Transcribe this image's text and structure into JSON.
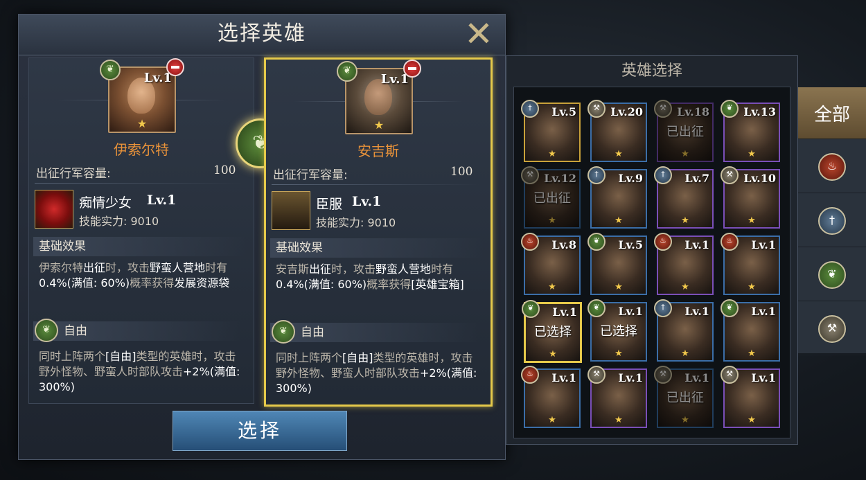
{
  "dialog": {
    "title": "选择英雄",
    "select_button": "选择"
  },
  "left_card": {
    "level": "Lv.1",
    "name": "伊索尔特",
    "capacity_label": "出征行军容量:",
    "capacity_value": "100",
    "skill_name": "痴情少女",
    "skill_level": "Lv.1",
    "skill_power": "技能实力: 9010",
    "section_title": "基础效果",
    "desc_parts": [
      "伊索尔特",
      "出征",
      "时，攻击",
      "野蛮人营地",
      "时有",
      "0.4%(满值: 60%)",
      "概率获得",
      "发展资源袋"
    ],
    "trait_name": "自由",
    "trait_parts": [
      "同时上阵两个",
      "[自由]",
      "类型的英雄时，攻击野外怪物、野蛮人时部队攻击",
      "+2%(满值: 300%)"
    ]
  },
  "right_card": {
    "level": "Lv.1",
    "name": "安吉斯",
    "capacity_label": "出征行军容量:",
    "capacity_value": "100",
    "skill_name": "臣服",
    "skill_level": "Lv.1",
    "skill_power": "技能实力: 9010",
    "section_title": "基础效果",
    "desc_parts": [
      "安吉斯",
      "出征",
      "时，攻击",
      "野蛮人营地",
      "时有",
      "0.4%(满值: 60%)",
      "概率获得",
      "[英雄宝箱]"
    ],
    "trait_name": "自由",
    "trait_parts": [
      "同时上阵两个",
      "[自由]",
      "类型的英雄时，攻击野外怪物、野蛮人时部队攻击",
      "+2%(满值: 300%)"
    ]
  },
  "picker": {
    "title": "英雄选择",
    "cells": [
      {
        "lv": "Lv.5",
        "badge": "sword",
        "state": ""
      },
      {
        "lv": "Lv.20",
        "badge": "hammer",
        "state": ""
      },
      {
        "lv": "Lv.18",
        "badge": "hammer",
        "state": "已出征"
      },
      {
        "lv": "Lv.13",
        "badge": "leaf",
        "state": ""
      },
      {
        "lv": "Lv.12",
        "badge": "hammer",
        "state": "已出征"
      },
      {
        "lv": "Lv.9",
        "badge": "sword",
        "state": ""
      },
      {
        "lv": "Lv.7",
        "badge": "sword",
        "state": ""
      },
      {
        "lv": "Lv.10",
        "badge": "hammer",
        "state": ""
      },
      {
        "lv": "Lv.8",
        "badge": "fire",
        "state": ""
      },
      {
        "lv": "Lv.5",
        "badge": "leaf",
        "state": ""
      },
      {
        "lv": "Lv.1",
        "badge": "fire",
        "state": ""
      },
      {
        "lv": "Lv.1",
        "badge": "fire",
        "state": ""
      },
      {
        "lv": "Lv.1",
        "badge": "leaf",
        "state": "已选择"
      },
      {
        "lv": "Lv.1",
        "badge": "leaf",
        "state": "已选择"
      },
      {
        "lv": "Lv.1",
        "badge": "sword",
        "state": ""
      },
      {
        "lv": "Lv.1",
        "badge": "leaf",
        "state": ""
      },
      {
        "lv": "Lv.1",
        "badge": "fire",
        "state": ""
      },
      {
        "lv": "Lv.1",
        "badge": "hammer",
        "state": ""
      },
      {
        "lv": "Lv.1",
        "badge": "hammer",
        "state": "已出征"
      },
      {
        "lv": "Lv.1",
        "badge": "hammer",
        "state": ""
      }
    ]
  },
  "tabs": {
    "all_label": "全部",
    "icons": [
      "fire-icon",
      "sword-icon",
      "leaf-icon",
      "hammer-icon"
    ]
  },
  "colors": {
    "accent_gold": "#e5c94a",
    "name_orange": "#e8923a",
    "button_blue": "#3a6f9e"
  }
}
